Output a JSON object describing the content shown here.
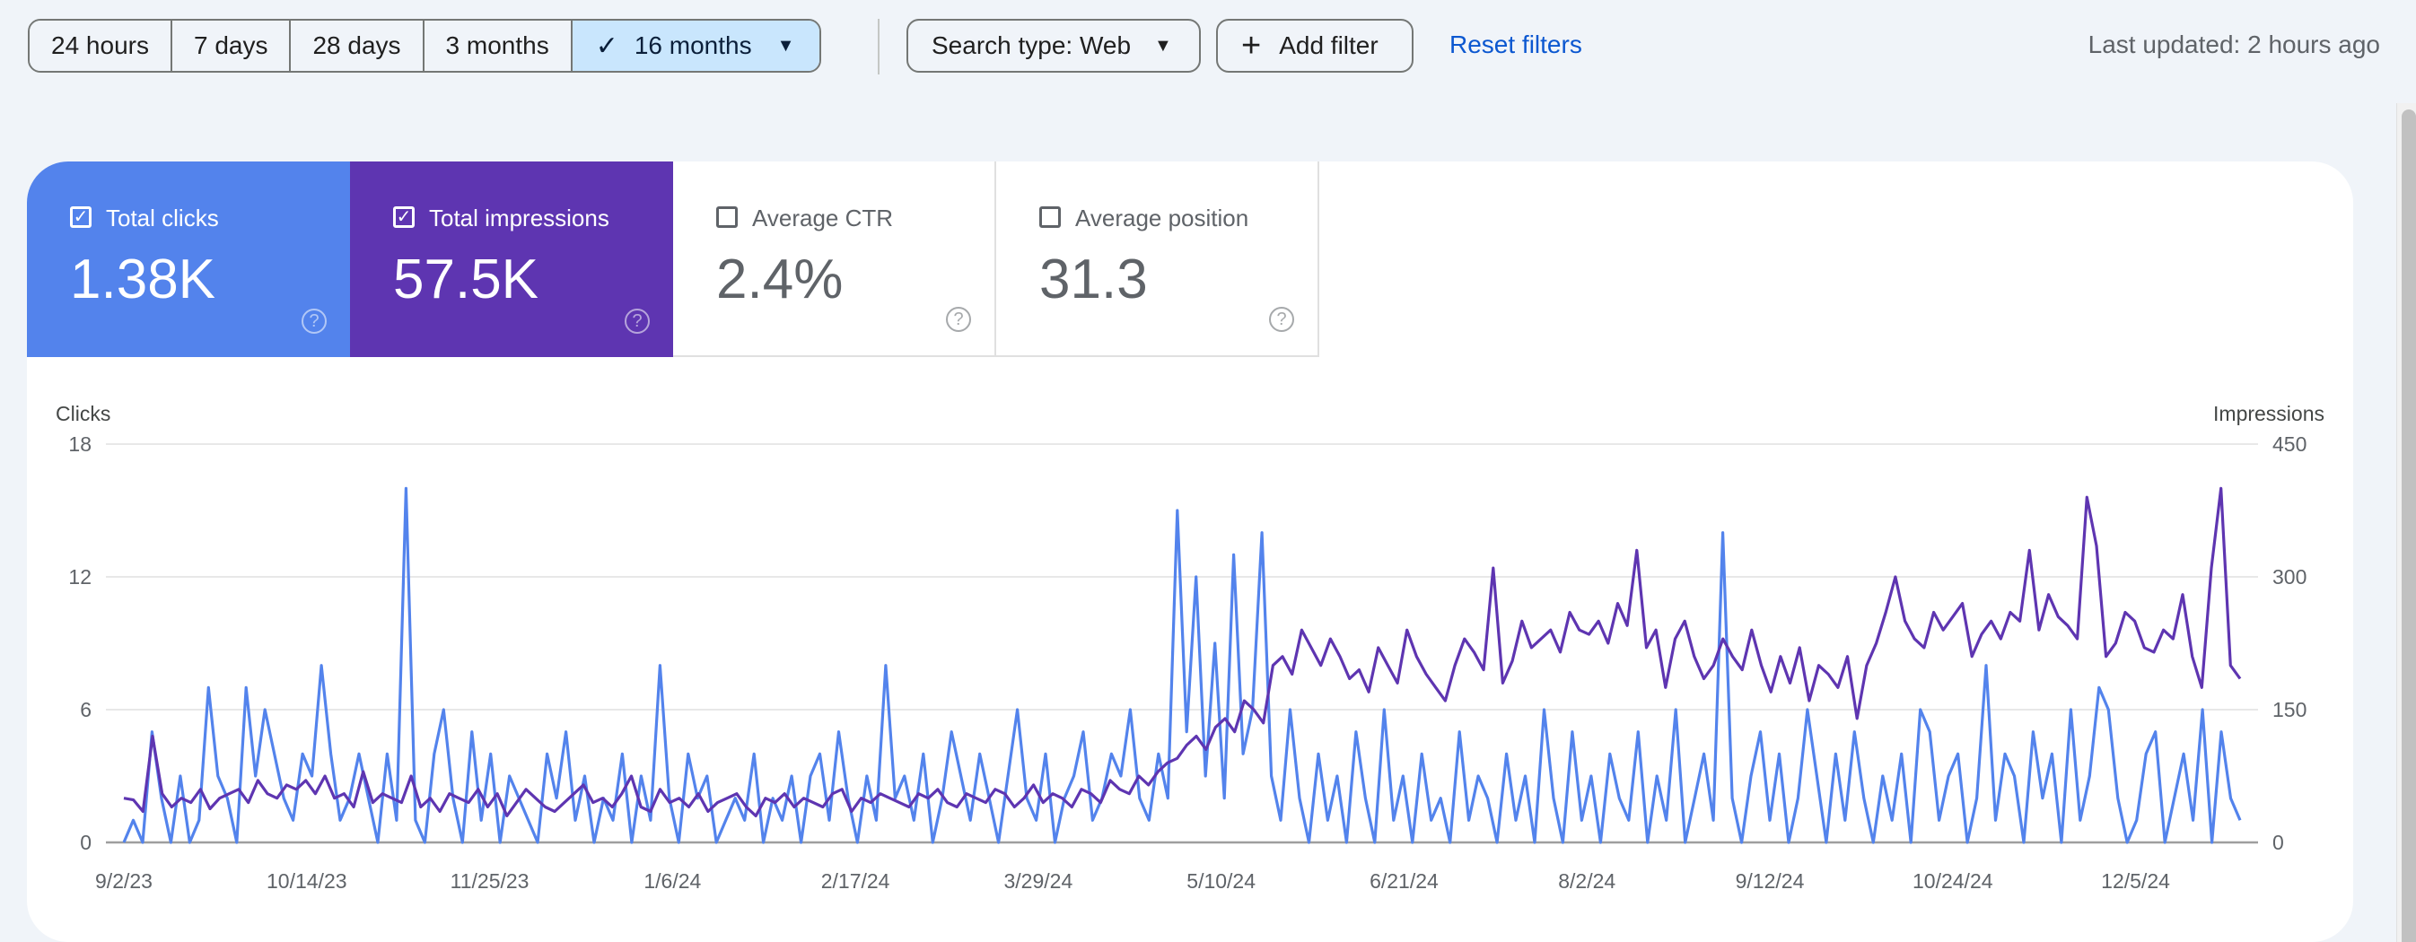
{
  "toolbar": {
    "ranges": [
      "24 hours",
      "7 days",
      "28 days",
      "3 months",
      "16 months"
    ],
    "active_range": "16 months",
    "search_type_label": "Search type: Web",
    "add_filter_label": "Add filter",
    "reset_filters_label": "Reset filters",
    "last_updated": "Last updated: 2 hours ago"
  },
  "metrics": [
    {
      "label": "Total clicks",
      "value": "1.38K",
      "checked": true,
      "color": "#5383ec"
    },
    {
      "label": "Total impressions",
      "value": "57.5K",
      "checked": true,
      "color": "#5e35b1"
    },
    {
      "label": "Average CTR",
      "value": "2.4%",
      "checked": false
    },
    {
      "label": "Average position",
      "value": "31.3",
      "checked": false
    }
  ],
  "chart_data": {
    "type": "line",
    "left_axis_title": "Clicks",
    "right_axis_title": "Impressions",
    "left_ylim": [
      0,
      18
    ],
    "right_ylim": [
      0,
      450
    ],
    "left_ticks": [
      "0",
      "6",
      "12",
      "18"
    ],
    "right_ticks": [
      "0",
      "150",
      "300",
      "450"
    ],
    "x_tick_labels": [
      "9/2/23",
      "10/14/23",
      "11/25/23",
      "1/6/24",
      "2/17/24",
      "3/29/24",
      "5/10/24",
      "6/21/24",
      "8/2/24",
      "9/12/24",
      "10/24/24",
      "12/5/24"
    ],
    "x_start": "9/2/23",
    "x_end": "12/31/24",
    "grid": true,
    "series": [
      {
        "name": "Clicks",
        "axis": "left",
        "color": "#5383ec",
        "values": [
          0,
          1,
          0,
          5,
          2,
          0,
          3,
          0,
          1,
          7,
          3,
          2,
          0,
          7,
          3,
          6,
          4,
          2,
          1,
          4,
          3,
          8,
          4,
          1,
          2,
          4,
          2,
          0,
          4,
          1,
          16,
          1,
          0,
          4,
          6,
          2,
          0,
          5,
          1,
          4,
          0,
          3,
          2,
          1,
          0,
          4,
          2,
          5,
          1,
          3,
          0,
          2,
          1,
          4,
          0,
          3,
          1,
          8,
          2,
          0,
          4,
          2,
          3,
          0,
          1,
          2,
          1,
          4,
          0,
          2,
          1,
          3,
          0,
          3,
          4,
          1,
          5,
          2,
          0,
          3,
          1,
          8,
          2,
          3,
          1,
          4,
          0,
          2,
          5,
          3,
          1,
          4,
          2,
          0,
          3,
          6,
          2,
          1,
          4,
          0,
          2,
          3,
          5,
          1,
          2,
          4,
          3,
          6,
          2,
          1,
          4,
          2,
          15,
          5,
          12,
          3,
          9,
          2,
          13,
          4,
          6,
          14,
          3,
          1,
          6,
          2,
          0,
          4,
          1,
          3,
          0,
          5,
          2,
          0,
          6,
          1,
          3,
          0,
          4,
          1,
          2,
          0,
          5,
          1,
          3,
          2,
          0,
          4,
          1,
          3,
          0,
          6,
          2,
          0,
          5,
          1,
          3,
          0,
          4,
          2,
          1,
          5,
          0,
          3,
          1,
          6,
          0,
          2,
          4,
          1,
          14,
          2,
          0,
          3,
          5,
          1,
          4,
          0,
          2,
          6,
          3,
          0,
          4,
          1,
          5,
          2,
          0,
          3,
          1,
          4,
          0,
          6,
          5,
          1,
          3,
          4,
          0,
          2,
          8,
          1,
          4,
          3,
          0,
          5,
          2,
          4,
          0,
          6,
          1,
          3,
          7,
          6,
          2,
          0,
          1,
          4,
          5,
          0,
          2,
          4,
          1,
          6,
          0,
          5,
          2,
          1
        ]
      },
      {
        "name": "Impressions",
        "axis": "right",
        "color": "#5e35b1",
        "values": [
          50,
          48,
          35,
          120,
          55,
          40,
          50,
          45,
          60,
          38,
          50,
          55,
          60,
          45,
          70,
          55,
          50,
          65,
          60,
          70,
          55,
          75,
          50,
          55,
          40,
          80,
          45,
          55,
          50,
          45,
          75,
          40,
          50,
          35,
          55,
          50,
          45,
          60,
          40,
          55,
          30,
          45,
          60,
          50,
          40,
          35,
          45,
          55,
          65,
          45,
          50,
          40,
          55,
          75,
          40,
          35,
          60,
          45,
          50,
          40,
          55,
          35,
          45,
          50,
          55,
          40,
          30,
          50,
          45,
          55,
          40,
          50,
          45,
          40,
          55,
          60,
          35,
          50,
          45,
          55,
          50,
          45,
          40,
          55,
          50,
          60,
          45,
          40,
          55,
          50,
          45,
          60,
          55,
          40,
          50,
          65,
          45,
          55,
          50,
          40,
          60,
          55,
          45,
          70,
          60,
          55,
          75,
          65,
          80,
          90,
          95,
          110,
          120,
          105,
          130,
          140,
          125,
          160,
          150,
          135,
          200,
          210,
          190,
          240,
          220,
          200,
          230,
          210,
          185,
          195,
          170,
          220,
          200,
          180,
          240,
          210,
          190,
          175,
          160,
          200,
          230,
          215,
          195,
          310,
          180,
          205,
          250,
          220,
          230,
          240,
          215,
          260,
          240,
          235,
          250,
          225,
          270,
          245,
          330,
          220,
          240,
          175,
          230,
          250,
          210,
          185,
          200,
          230,
          210,
          195,
          240,
          200,
          170,
          210,
          180,
          220,
          160,
          200,
          190,
          175,
          210,
          140,
          200,
          225,
          260,
          300,
          250,
          230,
          220,
          260,
          240,
          255,
          270,
          210,
          235,
          250,
          230,
          260,
          250,
          330,
          240,
          280,
          255,
          245,
          230,
          390,
          335,
          210,
          225,
          260,
          250,
          220,
          215,
          240,
          230,
          280,
          210,
          175,
          310,
          400,
          200,
          185
        ]
      }
    ]
  }
}
